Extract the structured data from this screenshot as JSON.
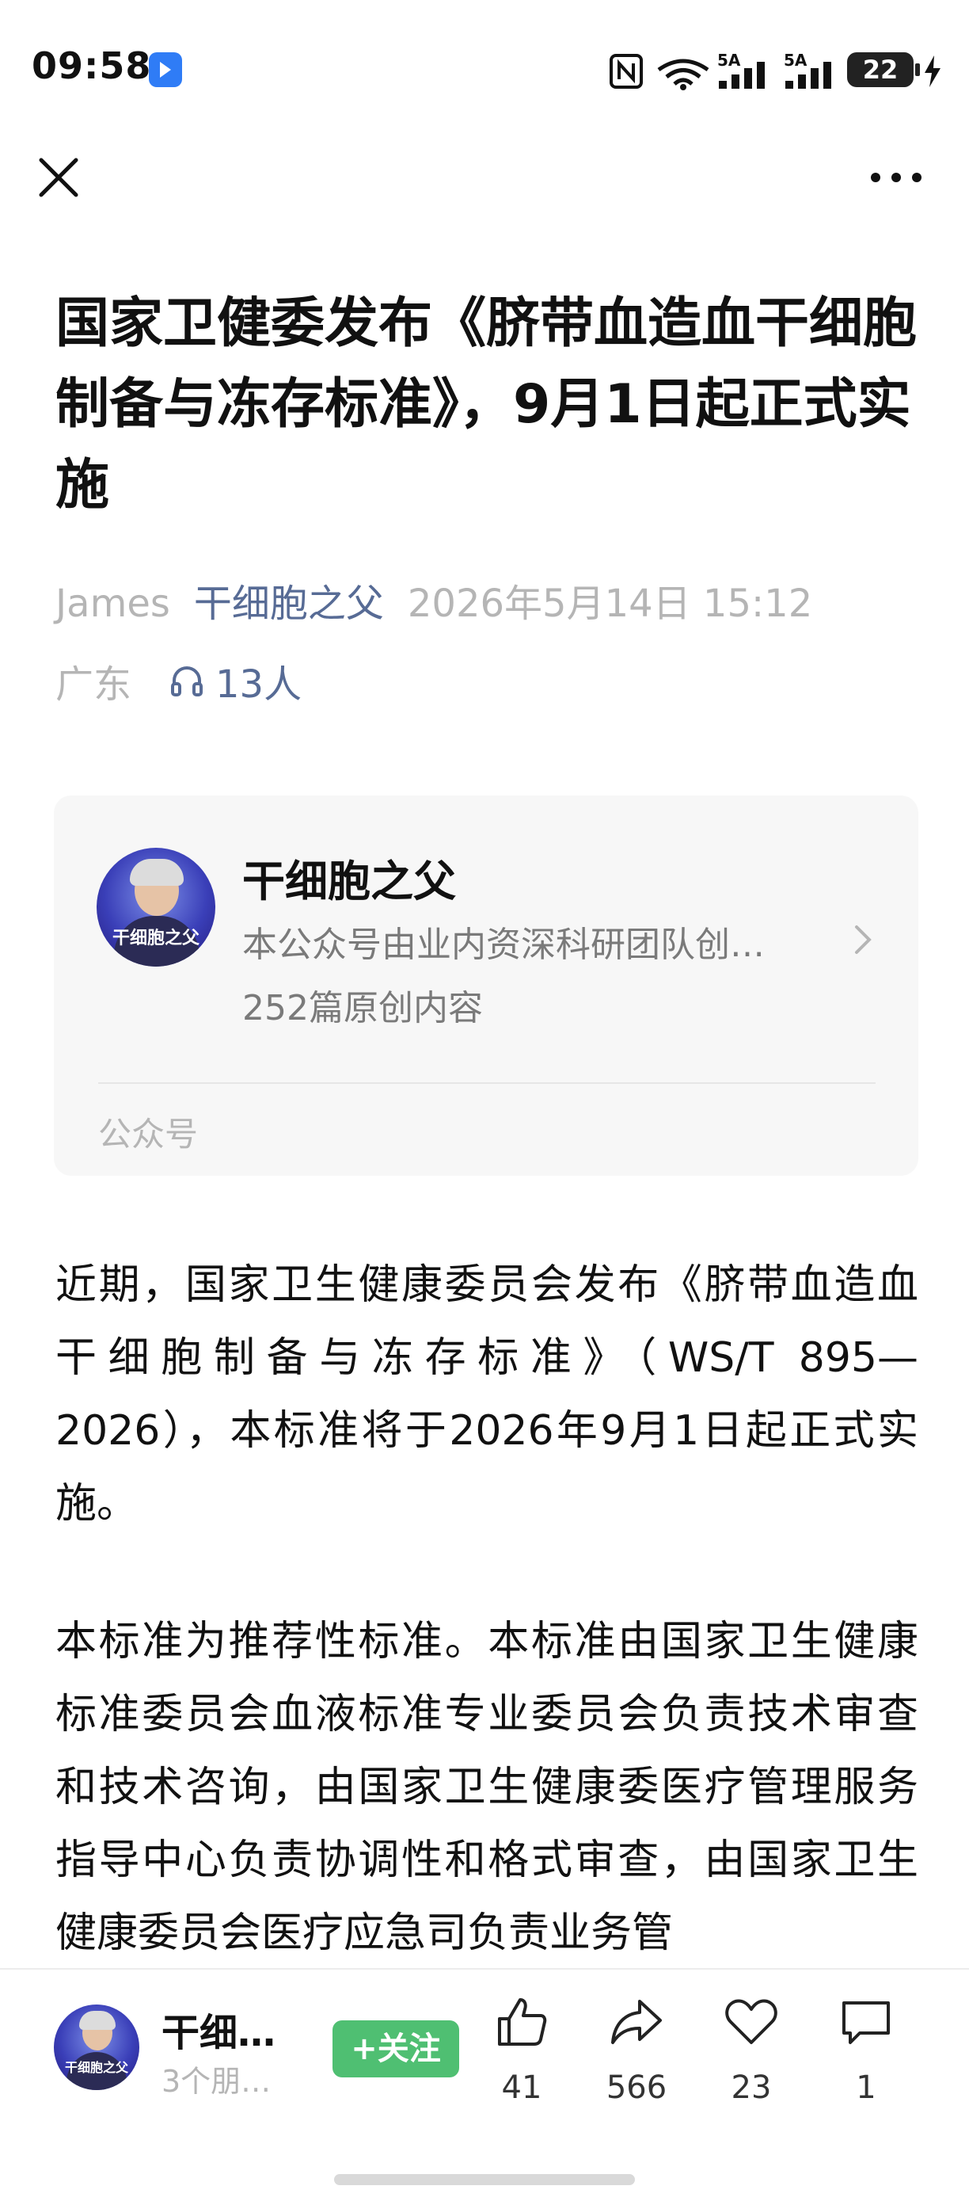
{
  "status_bar": {
    "time": "09:58",
    "signal_1_label": "5A",
    "signal_2_label": "5A",
    "battery": "22"
  },
  "nav": {
    "close_icon": "close-icon",
    "more_icon": "more-icon"
  },
  "article": {
    "title": "国家卫健委发布《脐带血造血干细胞制备与冻存标准》，9月1日起正式实施",
    "author": "James",
    "account": "干细胞之父",
    "date": "2026年5月14日 15:12",
    "location": "广东",
    "listeners": "13人",
    "paragraphs": [
      "近期，国家卫生健康委员会发布《脐带血造血干细胞制备与冻存标准》（WS/T 895—2026），本标准将于2026年9月1日起正式实施。",
      "本标准为推荐性标准。本标准由国家卫生健康标准委员会血液标准专业委员会负责技术审查和技术咨询，由国家卫生健康委医疗管理服务指导中心负责协调性和格式审查，由国家卫生健康委员会医疗应急司负责业务管"
    ]
  },
  "account_card": {
    "name": "干细胞之父",
    "description": "本公众号由业内资深科研团队创…",
    "count": "252篇原创内容",
    "type_label": "公众号",
    "avatar_text": "干细胞之父"
  },
  "bottom_bar": {
    "name": "干细…",
    "sub": "3个朋…",
    "follow_label": "+关注",
    "like_count": "41",
    "share_count": "566",
    "favorite_count": "23",
    "comment_count": "1"
  },
  "colors": {
    "link": "#576b95",
    "follow_green": "#4fbf72",
    "meta_gray": "#b5b5b5"
  }
}
